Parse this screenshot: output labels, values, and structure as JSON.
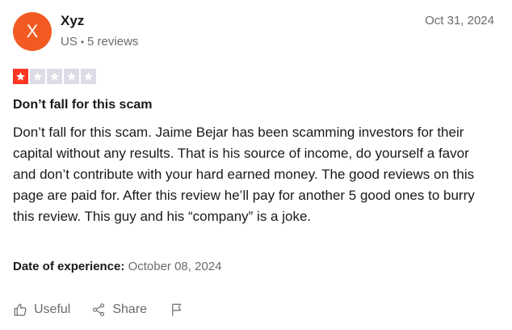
{
  "reviewer": {
    "avatar_initial": "X",
    "avatar_color": "#f25a22",
    "name": "Xyz",
    "country": "US",
    "separator": "•",
    "review_count": "5 reviews"
  },
  "review": {
    "date": "Oct 31, 2024",
    "rating": {
      "value": 1,
      "max": 5,
      "filled_color": "#ff3722",
      "empty_color": "#dcdce6"
    },
    "title": "Don’t fall for this scam",
    "body": "Don’t fall for this scam. Jaime Bejar has been scamming investors for their capital without any results. That is his source of income, do yourself a favor and don’t contribute with your hard earned money. The good reviews on this page are paid for. After this review he’ll pay for another 5 good ones to burry this review. This guy and his “company” is a joke.",
    "experience_label": "Date of experience:",
    "experience_date": "October 08, 2024"
  },
  "actions": {
    "useful_label": "Useful",
    "useful_icon": "thumbs-up-icon",
    "share_label": "Share",
    "share_icon": "share-icon",
    "report_icon": "flag-icon"
  }
}
